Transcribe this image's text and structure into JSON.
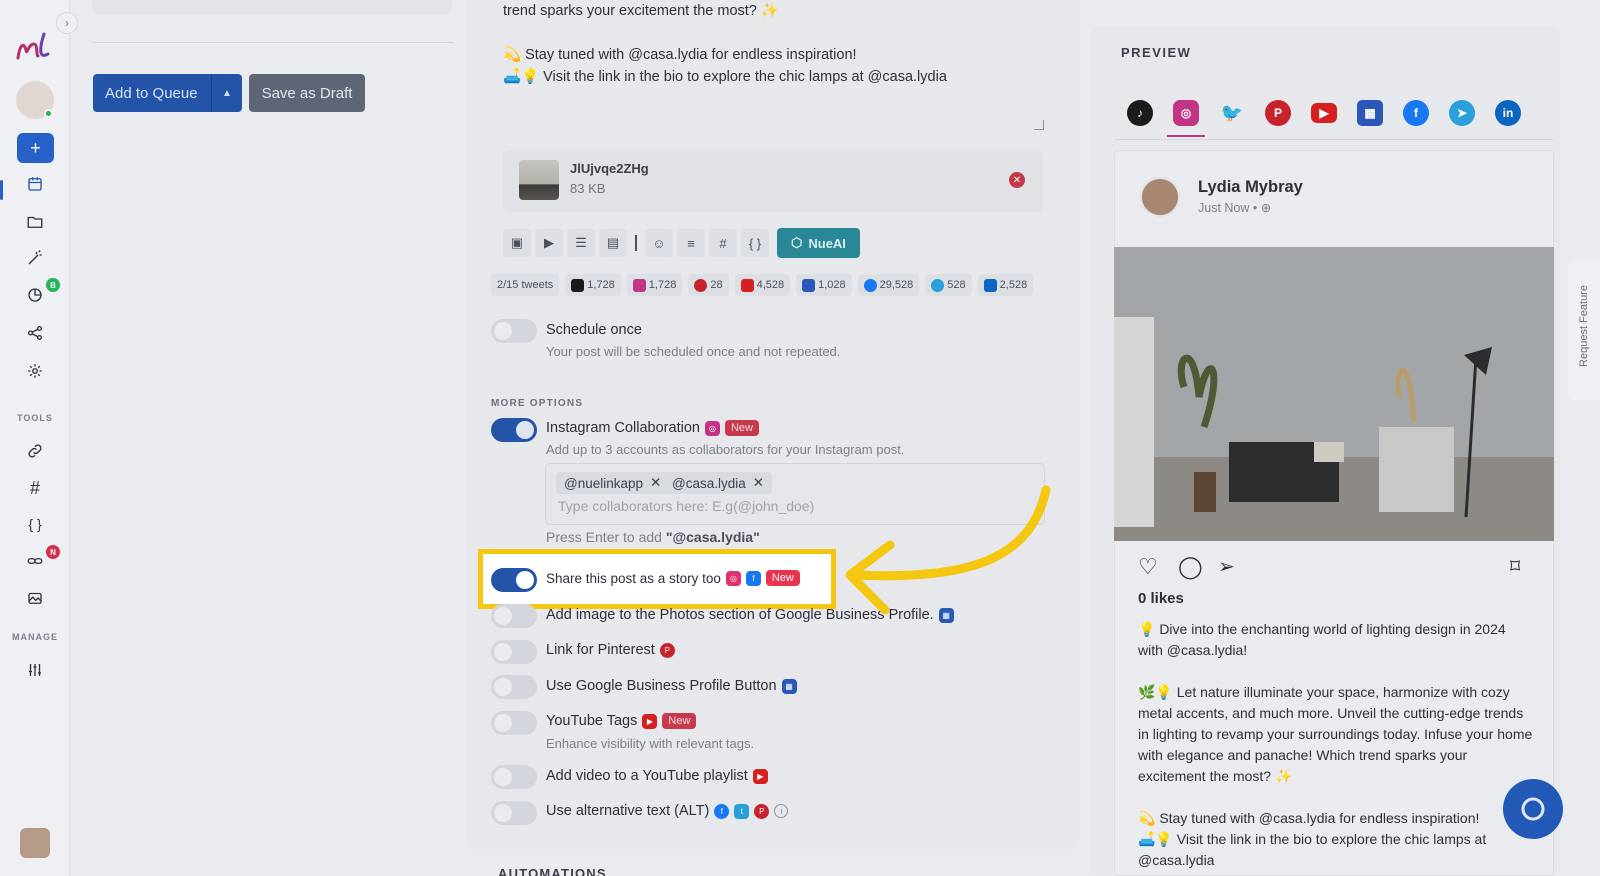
{
  "sidebar": {
    "sections": {
      "tools": "TOOLS",
      "manage": "MANAGE"
    },
    "badges": {
      "analytics": "B",
      "links": "N"
    }
  },
  "actions": {
    "add_to_queue": "Add to Queue",
    "save_draft": "Save as Draft"
  },
  "editor": {
    "lines": [
      "trend sparks your excitement the most? ✨",
      "",
      "💫 Stay tuned with @casa.lydia for endless inspiration!",
      "🛋️💡 Visit the link in the bio to explore the chic lamps at @casa.lydia"
    ],
    "media": {
      "name": "JlUjvqe2ZHg",
      "size": "83 KB"
    },
    "nueai_label": "NueAI"
  },
  "counters": [
    {
      "label": "2/15 tweets",
      "color": ""
    },
    {
      "label": "1,728",
      "color": "#1b1b1b"
    },
    {
      "label": "1,728",
      "color": "#c13584"
    },
    {
      "label": "28",
      "color": "#c8232c"
    },
    {
      "label": "4,528",
      "color": "#d62020"
    },
    {
      "label": "1,028",
      "color": "#2b58b8"
    },
    {
      "label": "29,528",
      "color": "#1877f2"
    },
    {
      "label": "528",
      "color": "#2aa0da"
    },
    {
      "label": "2,528",
      "color": "#0a66c2"
    }
  ],
  "schedule": {
    "label": "Schedule once",
    "sub": "Your post will be scheduled once and not repeated."
  },
  "more_options": {
    "title": "MORE OPTIONS",
    "instagram_collab": {
      "label": "Instagram Collaboration",
      "badge": "New",
      "sub": "Add up to 3 accounts as collaborators for your Instagram post."
    },
    "collaborators": [
      "@nuelinkapp",
      "@casa.lydia"
    ],
    "collab_placeholder": "Type collaborators here: E.g(@john_doe)",
    "enter_hint_prefix": "Press Enter to add ",
    "enter_hint_value": "\"@casa.lydia\"",
    "story": {
      "label": "Share this post as a story too",
      "badge": "New"
    },
    "gbp_photos": {
      "label": "Add image to the Photos section of Google Business Profile."
    },
    "pinterest_link": {
      "label": "Link for Pinterest"
    },
    "gbp_button": {
      "label": "Use Google Business Profile Button"
    },
    "youtube_tags": {
      "label": "YouTube Tags",
      "badge": "New",
      "sub": "Enhance visibility with relevant tags."
    },
    "youtube_playlist": {
      "label": "Add video to a YouTube playlist"
    },
    "alt_text": {
      "label": "Use alternative text (ALT)"
    }
  },
  "automations_title": "AUTOMATIONS",
  "preview": {
    "title": "PREVIEW",
    "networks": [
      "tiktok-icon",
      "instagram-icon",
      "twitter-icon",
      "pinterest-icon",
      "youtube-icon",
      "google-business-icon",
      "facebook-icon",
      "telegram-icon",
      "linkedin-icon"
    ],
    "user_name": "Lydia Mybray",
    "time": "Just Now •",
    "likes": "0 likes",
    "caption": [
      "💡 Dive into the enchanting world of lighting design in 2024 with @casa.lydia!",
      "",
      "🌿💡 Let nature illuminate your space, harmonize with cozy metal accents, and much more. Unveil the cutting-edge trends in lighting to revamp your surroundings today. Infuse your home with elegance and panache! Which trend sparks your excitement the most? ✨",
      "",
      "💫 Stay tuned with @casa.lydia for endless inspiration!",
      "🛋️💡 Visit the link in the bio to explore the chic lamps at @casa.lydia"
    ]
  },
  "request_feature": "Request Feature",
  "colors": {
    "accent": "#2354a8",
    "highlight": "#f5c710",
    "new_badge": "#c73a4d",
    "nueai": "#2a8796"
  }
}
